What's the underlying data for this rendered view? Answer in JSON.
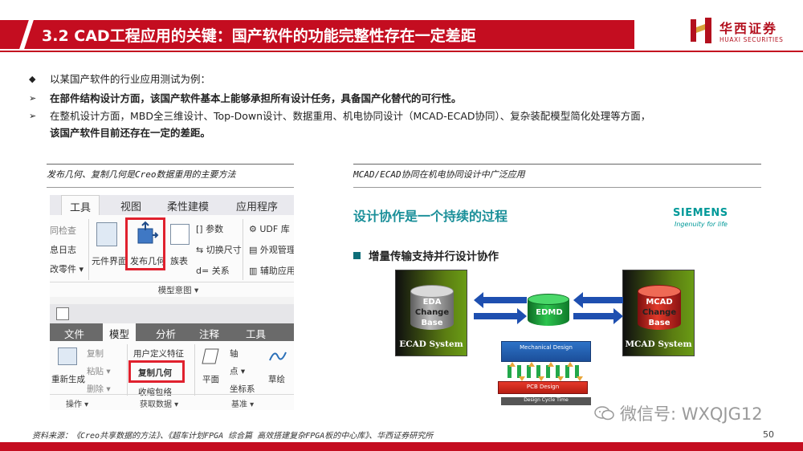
{
  "header": {
    "title": "3.2 CAD工程应用的关键：国产软件的功能完整性存在一定差距",
    "logo_cn": "华西证券",
    "logo_en": "HUAXI SECURITIES"
  },
  "bullets": [
    {
      "symbol": "◆",
      "text": "以某国产软件的行业应用测试为例："
    },
    {
      "symbol": "➢",
      "text": "在部件结构设计方面，该国产软件基本上能够承担所有设计任务，具备国产化替代的可行性。"
    },
    {
      "symbol": "➢",
      "text": "在整机设计方面，MBD全三维设计、Top-Down设计、数据重用、机电协同设计（MCAD-ECAD协同）、复杂装配模型简化处理等方面，"
    },
    {
      "symbol": "",
      "text": "该国产软件目前还存在一定的差距。"
    }
  ],
  "left_panel": {
    "caption": "发布几何、复制几何是Creo数据重用的主要方法",
    "ribbon1": {
      "tabs": [
        "工具",
        "视图",
        "柔性建模",
        "应用程序"
      ],
      "left_items": [
        "同检查",
        "息日志",
        "改零件 ▾"
      ],
      "buttons": [
        "元件界面",
        "发布几何",
        "族表"
      ],
      "side_items": [
        "参数",
        "切换尺寸",
        "关系"
      ],
      "right_items": [
        "UDF 库",
        "外观管理",
        "辅助应用"
      ],
      "group_label": "模型意图 ▾"
    },
    "ribbon2": {
      "tabs": [
        "文件",
        "模型",
        "分析",
        "注释",
        "工具"
      ],
      "items": [
        "复制",
        "粘贴 ▾",
        "删除 ▾",
        "重新生成",
        "用户定义特征",
        "复制几何",
        "收缩包络",
        "平面",
        "轴",
        "点 ▾",
        "坐标系",
        "草绘"
      ],
      "footers": [
        "操作 ▾",
        "获取数据 ▾",
        "基准 ▾"
      ]
    }
  },
  "right_panel": {
    "caption": "MCAD/ECAD协同在机电协同设计中广泛应用",
    "heading": "设计协作是一个持续的过程",
    "brand": "SIEMENS",
    "brand_tagline": "Ingenuity for life",
    "subheading": "增量传输支持并行设计协作",
    "ecad_db": [
      "EDA",
      "Change",
      "Base"
    ],
    "ecad_label": "ECAD System",
    "edmd_label": "EDMD",
    "mcad_db": [
      "MCAD",
      "Change",
      "Base"
    ],
    "mcad_label": "MCAD System",
    "pcb_top": "Mechanical Design",
    "pcb_bottom": "PCB Design",
    "pcb_cycle": "Design Cycle Time"
  },
  "footer": {
    "source": "资料来源：《Creo共享数据的方法》、《超车计划FPGA 综合篇 高效搭建复杂FPGA板的中心库》、华西证券研究所",
    "page": "50",
    "watermark": "微信号: WXQJG12"
  },
  "colors": {
    "brand_red": "#c40d20",
    "teal": "#1a8f99",
    "highlight_red": "#e0212e"
  }
}
